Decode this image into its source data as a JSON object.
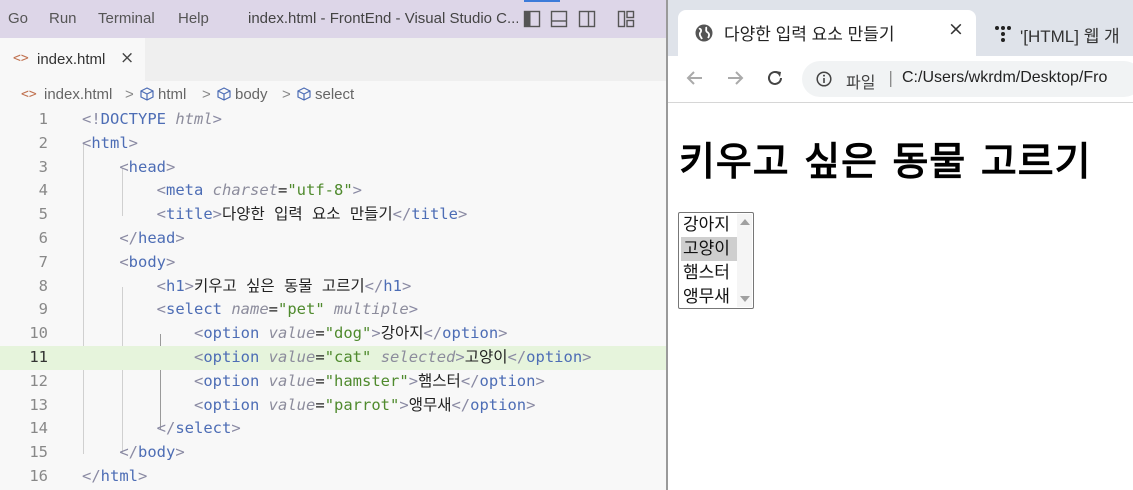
{
  "vscode": {
    "menu": [
      "Go",
      "Run",
      "Terminal",
      "Help"
    ],
    "window_title": "index.html - FrontEnd - Visual Studio C...",
    "layout_icons": [
      "toggle-primary-sidebar-icon",
      "toggle-panel-icon",
      "toggle-secondary-sidebar-icon",
      "customize-layout-icon"
    ],
    "tab": {
      "icon": "<>",
      "label": "index.html",
      "close": "×"
    },
    "breadcrumb": {
      "file_icon": "<>",
      "items": [
        "index.html",
        "html",
        "body",
        "select"
      ],
      "separator": ">"
    },
    "highlighted_line": 11,
    "lines": [
      {
        "n": "1",
        "tokens": [
          {
            "c": "p",
            "t": "<!"
          },
          {
            "c": "t",
            "t": "DOCTYPE"
          },
          {
            "c": "x",
            "t": " "
          },
          {
            "c": "a",
            "t": "html"
          },
          {
            "c": "p",
            "t": ">"
          }
        ]
      },
      {
        "n": "2",
        "tokens": [
          {
            "c": "p",
            "t": "<"
          },
          {
            "c": "t",
            "t": "html"
          },
          {
            "c": "p",
            "t": ">"
          }
        ]
      },
      {
        "n": "3",
        "tokens": [
          {
            "c": "x",
            "t": "    "
          },
          {
            "c": "p",
            "t": "<"
          },
          {
            "c": "t",
            "t": "head"
          },
          {
            "c": "p",
            "t": ">"
          }
        ]
      },
      {
        "n": "4",
        "tokens": [
          {
            "c": "x",
            "t": "        "
          },
          {
            "c": "p",
            "t": "<"
          },
          {
            "c": "t",
            "t": "meta"
          },
          {
            "c": "x",
            "t": " "
          },
          {
            "c": "a",
            "t": "charset"
          },
          {
            "c": "x",
            "t": "="
          },
          {
            "c": "s",
            "t": "\"utf-8\""
          },
          {
            "c": "p",
            "t": ">"
          }
        ]
      },
      {
        "n": "5",
        "tokens": [
          {
            "c": "x",
            "t": "        "
          },
          {
            "c": "p",
            "t": "<"
          },
          {
            "c": "t",
            "t": "title"
          },
          {
            "c": "p",
            "t": ">"
          },
          {
            "c": "x",
            "t": "다양한 입력 요소 만들기"
          },
          {
            "c": "p",
            "t": "</"
          },
          {
            "c": "t",
            "t": "title"
          },
          {
            "c": "p",
            "t": ">"
          }
        ]
      },
      {
        "n": "6",
        "tokens": [
          {
            "c": "x",
            "t": "    "
          },
          {
            "c": "p",
            "t": "</"
          },
          {
            "c": "t",
            "t": "head"
          },
          {
            "c": "p",
            "t": ">"
          }
        ]
      },
      {
        "n": "7",
        "tokens": [
          {
            "c": "x",
            "t": "    "
          },
          {
            "c": "p",
            "t": "<"
          },
          {
            "c": "t",
            "t": "body"
          },
          {
            "c": "p",
            "t": ">"
          }
        ]
      },
      {
        "n": "8",
        "tokens": [
          {
            "c": "x",
            "t": "        "
          },
          {
            "c": "p",
            "t": "<"
          },
          {
            "c": "t",
            "t": "h1"
          },
          {
            "c": "p",
            "t": ">"
          },
          {
            "c": "x",
            "t": "키우고 싶은 동물 고르기"
          },
          {
            "c": "p",
            "t": "</"
          },
          {
            "c": "t",
            "t": "h1"
          },
          {
            "c": "p",
            "t": ">"
          }
        ]
      },
      {
        "n": "9",
        "tokens": [
          {
            "c": "x",
            "t": "        "
          },
          {
            "c": "p",
            "t": "<"
          },
          {
            "c": "t",
            "t": "select"
          },
          {
            "c": "x",
            "t": " "
          },
          {
            "c": "a",
            "t": "name"
          },
          {
            "c": "x",
            "t": "="
          },
          {
            "c": "s",
            "t": "\"pet\""
          },
          {
            "c": "x",
            "t": " "
          },
          {
            "c": "a",
            "t": "multiple"
          },
          {
            "c": "p",
            "t": ">"
          }
        ]
      },
      {
        "n": "10",
        "tokens": [
          {
            "c": "x",
            "t": "            "
          },
          {
            "c": "p",
            "t": "<"
          },
          {
            "c": "t",
            "t": "option"
          },
          {
            "c": "x",
            "t": " "
          },
          {
            "c": "a",
            "t": "value"
          },
          {
            "c": "x",
            "t": "="
          },
          {
            "c": "s",
            "t": "\"dog\""
          },
          {
            "c": "p",
            "t": ">"
          },
          {
            "c": "x",
            "t": "강아지"
          },
          {
            "c": "p",
            "t": "</"
          },
          {
            "c": "t",
            "t": "option"
          },
          {
            "c": "p",
            "t": ">"
          }
        ]
      },
      {
        "n": "11",
        "tokens": [
          {
            "c": "x",
            "t": "            "
          },
          {
            "c": "p",
            "t": "<"
          },
          {
            "c": "t",
            "t": "option"
          },
          {
            "c": "x",
            "t": " "
          },
          {
            "c": "a",
            "t": "value"
          },
          {
            "c": "x",
            "t": "="
          },
          {
            "c": "s",
            "t": "\"cat\""
          },
          {
            "c": "x",
            "t": " "
          },
          {
            "c": "a",
            "t": "selected"
          },
          {
            "c": "p",
            "t": ">"
          },
          {
            "c": "x",
            "t": "고양이"
          },
          {
            "c": "p",
            "t": "</"
          },
          {
            "c": "t",
            "t": "option"
          },
          {
            "c": "p",
            "t": ">"
          }
        ]
      },
      {
        "n": "12",
        "tokens": [
          {
            "c": "x",
            "t": "            "
          },
          {
            "c": "p",
            "t": "<"
          },
          {
            "c": "t",
            "t": "option"
          },
          {
            "c": "x",
            "t": " "
          },
          {
            "c": "a",
            "t": "value"
          },
          {
            "c": "x",
            "t": "="
          },
          {
            "c": "s",
            "t": "\"hamster\""
          },
          {
            "c": "p",
            "t": ">"
          },
          {
            "c": "x",
            "t": "햄스터"
          },
          {
            "c": "p",
            "t": "</"
          },
          {
            "c": "t",
            "t": "option"
          },
          {
            "c": "p",
            "t": ">"
          }
        ]
      },
      {
        "n": "13",
        "tokens": [
          {
            "c": "x",
            "t": "            "
          },
          {
            "c": "p",
            "t": "<"
          },
          {
            "c": "t",
            "t": "option"
          },
          {
            "c": "x",
            "t": " "
          },
          {
            "c": "a",
            "t": "value"
          },
          {
            "c": "x",
            "t": "="
          },
          {
            "c": "s",
            "t": "\"parrot\""
          },
          {
            "c": "p",
            "t": ">"
          },
          {
            "c": "x",
            "t": "앵무새"
          },
          {
            "c": "p",
            "t": "</"
          },
          {
            "c": "t",
            "t": "option"
          },
          {
            "c": "p",
            "t": ">"
          }
        ]
      },
      {
        "n": "14",
        "tokens": [
          {
            "c": "x",
            "t": "        "
          },
          {
            "c": "p",
            "t": "</"
          },
          {
            "c": "t",
            "t": "select"
          },
          {
            "c": "p",
            "t": ">"
          }
        ]
      },
      {
        "n": "15",
        "tokens": [
          {
            "c": "x",
            "t": "    "
          },
          {
            "c": "p",
            "t": "</"
          },
          {
            "c": "t",
            "t": "body"
          },
          {
            "c": "p",
            "t": ">"
          }
        ]
      },
      {
        "n": "16",
        "tokens": [
          {
            "c": "p",
            "t": "</"
          },
          {
            "c": "t",
            "t": "html"
          },
          {
            "c": "p",
            "t": ">"
          }
        ]
      }
    ]
  },
  "browser": {
    "active_tab": {
      "title": "다양한 입력 요소 만들기",
      "icon": "globe-icon",
      "close": "×"
    },
    "second_tab": {
      "title": "'[HTML] 웹 개",
      "icon": "tistory-icon"
    },
    "nav_icons": [
      "back-arrow-icon",
      "forward-arrow-icon",
      "reload-icon"
    ],
    "omnibox": {
      "scheme_label": "파일",
      "separator": "|",
      "url": "C:/Users/wkrdm/Desktop/Fro"
    },
    "page": {
      "heading": "키우고 싶은 동물 고르기",
      "select": {
        "options": [
          "강아지",
          "고양이",
          "햄스터",
          "앵무새"
        ],
        "selected_index": 1
      }
    }
  },
  "colors": {
    "menubar_bg": "#ddd6e8",
    "editor_bg": "#f8f8f8",
    "line_highlight": "#e6f4dc",
    "tag_color": "#4d6db5",
    "attr_color": "#8c8c9c",
    "string_color": "#4f8a2d",
    "browser_tabbar_bg": "#dfe3ea",
    "selected_option_bg": "#cecece"
  }
}
